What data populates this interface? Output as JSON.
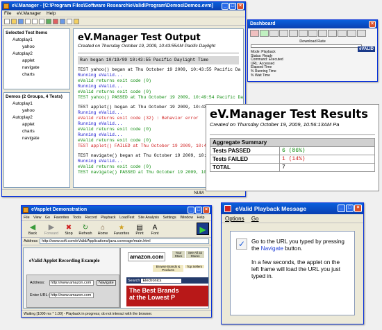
{
  "manager": {
    "title": "eV.Manager - [C:\\Program Files\\Software Research\\eValid\\Program\\Demos\\Demos.evm]",
    "menu": [
      "File",
      "eV.Manager",
      "Help"
    ],
    "selected_header": "Selected Test Items",
    "selected_tree": [
      {
        "level": 1,
        "text": "Autoplay1"
      },
      {
        "level": 2,
        "text": "yahoo"
      },
      {
        "level": 1,
        "text": "Autoplay2"
      },
      {
        "level": 2,
        "text": "applet"
      },
      {
        "level": 2,
        "text": "navigate"
      },
      {
        "level": 2,
        "text": "charts"
      }
    ],
    "demos_header": "Demos (2 Groups, 4 Tests)",
    "demos_tree": [
      {
        "level": 1,
        "text": "Autoplay1"
      },
      {
        "level": 2,
        "text": "yahoo"
      },
      {
        "level": 1,
        "text": "Autoplay2"
      },
      {
        "level": 2,
        "text": "applet"
      },
      {
        "level": 2,
        "text": "charts"
      },
      {
        "level": 2,
        "text": "navigate"
      }
    ],
    "output_title": "eV.Manager Test Output",
    "output_subtitle": "Created on Thursday October 19, 2009, 10:43:55AM Pacific Daylight",
    "run_banner": "Run began 10/19/09 10:43:55 Pacific Daylight Time",
    "log": [
      {
        "c": "",
        "t": "TEST yahoo() began at Thu October 19 2009, 10:43:55 Pacific Da"
      },
      {
        "c": "blue",
        "t": "Running eValid..."
      },
      {
        "c": "green",
        "t": "eValid returns exit code (0)"
      },
      {
        "c": "blue",
        "t": "Running eValid..."
      },
      {
        "c": "green",
        "t": "eValid returns exit code (0)"
      },
      {
        "c": "green",
        "t": "TEST yahoo() PASSED at Thu October 19 2009, 10:49:54 Pacific Dayl"
      },
      {
        "c": "",
        "t": ""
      },
      {
        "c": "",
        "t": "TEST applet() began at Thu October 19 2009, 10:43:55 Pacific Da"
      },
      {
        "c": "blue",
        "t": "Running eValid..."
      },
      {
        "c": "red",
        "t": "eValid returns exit code (32) : Behavior error"
      },
      {
        "c": "blue",
        "t": "Running eValid..."
      },
      {
        "c": "green",
        "t": "eValid returns exit code (0)"
      },
      {
        "c": "blue",
        "t": "Running eValid..."
      },
      {
        "c": "green",
        "t": "eValid returns exit code (0)"
      },
      {
        "c": "red",
        "t": "TEST applet() FAILED at Thu October 19 2009, 10:4"
      },
      {
        "c": "",
        "t": ""
      },
      {
        "c": "",
        "t": "TEST navigate() began at Thu October 19 2009, 10:43"
      },
      {
        "c": "blue",
        "t": "Running eValid..."
      },
      {
        "c": "green",
        "t": "eValid returns exit code (0)"
      },
      {
        "c": "green",
        "t": "TEST navigate() PASSED at Thu October 19 2009, 10:4"
      }
    ],
    "status_right": "NUM"
  },
  "dashboard": {
    "title": "Dashboard",
    "download_label": "Download Rate",
    "logo": "eVALID",
    "fields": [
      "Mode: Playback",
      "Status: Ready",
      "Command: Executed",
      "URL: Accessed",
      "Elapsed Time",
      "% Running Time",
      "% Wait Time"
    ]
  },
  "results": {
    "title": "eV.Manager Test Results",
    "subtitle": "Created on Thursday October 19, 2009, 10:56:13AM Pa",
    "agg_header": "Aggregate Summary",
    "rows": [
      {
        "label": "Tests PASSED",
        "value": "6 (86%)",
        "cls": "green"
      },
      {
        "label": "Tests FAILED",
        "value": "1 (14%)",
        "cls": "red"
      },
      {
        "label": "TOTAL",
        "value": "7",
        "cls": ""
      }
    ]
  },
  "applet": {
    "title": "eVapplet Demonstration",
    "menu": [
      "File",
      "View",
      "Go",
      "Favorites",
      "Tools",
      "Record",
      "Playback",
      "LoadTest",
      "Site Analysis",
      "Settings",
      "Window",
      "Help"
    ],
    "nav": [
      "Back",
      "Forward",
      "Stop",
      "Refresh",
      "Home",
      "Favorites",
      "Print",
      "Font"
    ],
    "address_label": "Address",
    "address": "http://www.soft.com/eValid/Applications/java.coverage/main.html",
    "heading": "eValid Applet Recording Example",
    "addr_label": "Address:",
    "addr_value": "http://www.amazon.com",
    "navigate_btn": "Navigate",
    "enter_label": "Enter URL:",
    "enter_value": "http://www.amazon.com",
    "amazon": "amazon.com",
    "amazon_tab1": "Your Store",
    "amazon_tab2": "See All 32 Stores",
    "amazon_tab3": "Browse Brands & Products",
    "amazon_tab4": "Top Sellers",
    "search_label": "Search",
    "search_select": "Electronics",
    "banner1": "The Best Brands",
    "banner2": "at the Lowest P",
    "status": "Waiting [1000 ms * 1.00] - Playback in progress; do not interact with the browser."
  },
  "message": {
    "title": "eValid Playback Message",
    "menu": [
      "Options",
      "Go"
    ],
    "p1a": "Go to the URL you typed by pressing the ",
    "p1link": "Navigate",
    "p1b": " button.",
    "p2": "In a few seconds, the applet on the left frame will load the URL you just typed in."
  }
}
